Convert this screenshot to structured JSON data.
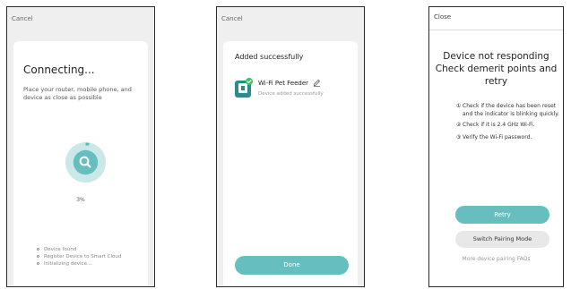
{
  "screen1": {
    "cancel_label": "Cancel",
    "title": "Connecting...",
    "description": "Place your router, mobile phone, and device as close as possible",
    "progress_text": "3%",
    "progress_value": 3,
    "accent_color": "#66bfbe",
    "steps": [
      "Device found",
      "Register Device to Smart Cloud",
      "Initializing device..."
    ]
  },
  "screen2": {
    "cancel_label": "Cancel",
    "title": "Added successfully",
    "device_name": "Wi-Fi Pet Feeder",
    "device_status": "Device added successfully",
    "done_label": "Done"
  },
  "screen3": {
    "close_label": "Close",
    "title_line1": "Device not responding",
    "title_line2": "Check demerit points and",
    "title_line3": "retry",
    "tips": [
      {
        "num": "①",
        "text": "Check if the device has been reset and the indicator is blinking quickly."
      },
      {
        "num": "②",
        "text": "Check if it is 2.4 GHz Wi-Fi."
      },
      {
        "num": "③",
        "text": "Verify the Wi-Fi password."
      }
    ],
    "retry_label": "Retry",
    "switch_label": "Switch Pairing Mode",
    "faq_label": "More device pairing FAQs"
  }
}
